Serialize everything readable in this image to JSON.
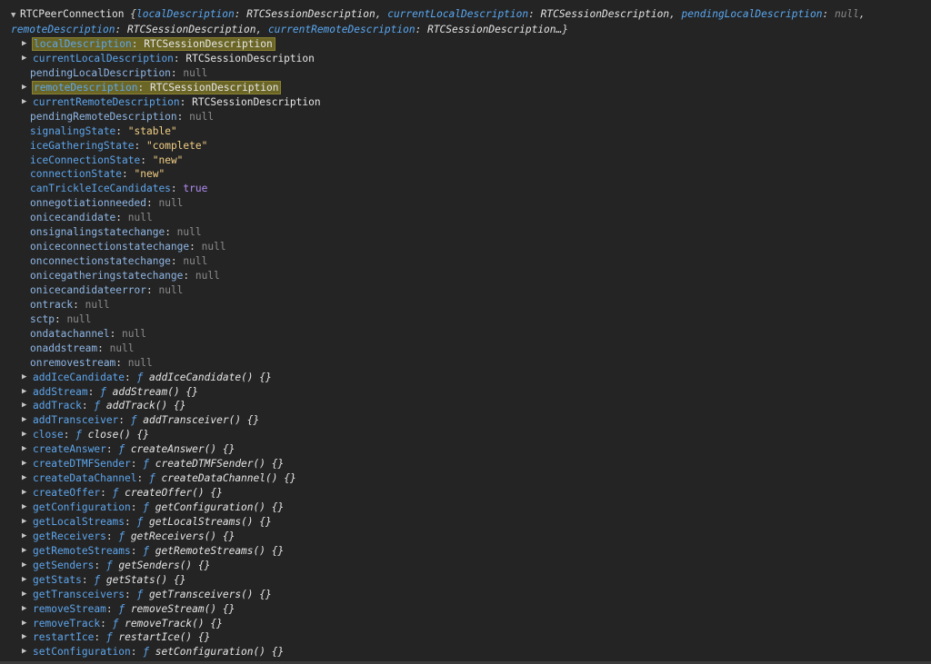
{
  "header": {
    "class_name": "RTCPeerConnection",
    "preview": [
      {
        "key": "localDescription",
        "value": "RTCSessionDescription",
        "type": "obj"
      },
      {
        "key": "currentLocalDescription",
        "value": "RTCSessionDescription",
        "type": "obj"
      },
      {
        "key": "pendingLocalDescription",
        "value": "null",
        "type": "null"
      },
      {
        "key": "remoteDescription",
        "value": "RTCSessionDescription",
        "type": "obj"
      },
      {
        "key": "currentRemoteDescription",
        "value": "RTCSessionDescription…",
        "type": "obj"
      }
    ]
  },
  "properties": [
    {
      "key": "localDescription",
      "value": "RTCSessionDescription",
      "type": "obj",
      "expandable": true,
      "highlight": true
    },
    {
      "key": "currentLocalDescription",
      "value": "RTCSessionDescription",
      "type": "obj",
      "expandable": true,
      "highlight": false
    },
    {
      "key": "pendingLocalDescription",
      "value": "null",
      "type": "null",
      "expandable": false
    },
    {
      "key": "remoteDescription",
      "value": "RTCSessionDescription",
      "type": "obj",
      "expandable": true,
      "highlight": true
    },
    {
      "key": "currentRemoteDescription",
      "value": "RTCSessionDescription",
      "type": "obj",
      "expandable": true,
      "highlight": false
    },
    {
      "key": "pendingRemoteDescription",
      "value": "null",
      "type": "null",
      "expandable": false
    },
    {
      "key": "signalingState",
      "value": "\"stable\"",
      "type": "str",
      "expandable": false
    },
    {
      "key": "iceGatheringState",
      "value": "\"complete\"",
      "type": "str",
      "expandable": false
    },
    {
      "key": "iceConnectionState",
      "value": "\"new\"",
      "type": "str",
      "expandable": false
    },
    {
      "key": "connectionState",
      "value": "\"new\"",
      "type": "str",
      "expandable": false
    },
    {
      "key": "canTrickleIceCandidates",
      "value": "true",
      "type": "bool",
      "expandable": false
    },
    {
      "key": "onnegotiationneeded",
      "value": "null",
      "type": "null",
      "expandable": false
    },
    {
      "key": "onicecandidate",
      "value": "null",
      "type": "null",
      "expandable": false
    },
    {
      "key": "onsignalingstatechange",
      "value": "null",
      "type": "null",
      "expandable": false
    },
    {
      "key": "oniceconnectionstatechange",
      "value": "null",
      "type": "null",
      "expandable": false
    },
    {
      "key": "onconnectionstatechange",
      "value": "null",
      "type": "null",
      "expandable": false
    },
    {
      "key": "onicegatheringstatechange",
      "value": "null",
      "type": "null",
      "expandable": false
    },
    {
      "key": "onicecandidateerror",
      "value": "null",
      "type": "null",
      "expandable": false
    },
    {
      "key": "ontrack",
      "value": "null",
      "type": "null",
      "expandable": false
    },
    {
      "key": "sctp",
      "value": "null",
      "type": "null",
      "expandable": false
    },
    {
      "key": "ondatachannel",
      "value": "null",
      "type": "null",
      "expandable": false
    },
    {
      "key": "onaddstream",
      "value": "null",
      "type": "null",
      "expandable": false
    },
    {
      "key": "onremovestream",
      "value": "null",
      "type": "null",
      "expandable": false
    },
    {
      "key": "addIceCandidate",
      "value": "addIceCandidate() {}",
      "type": "fn",
      "expandable": true
    },
    {
      "key": "addStream",
      "value": "addStream() {}",
      "type": "fn",
      "expandable": true
    },
    {
      "key": "addTrack",
      "value": "addTrack() {}",
      "type": "fn",
      "expandable": true
    },
    {
      "key": "addTransceiver",
      "value": "addTransceiver() {}",
      "type": "fn",
      "expandable": true
    },
    {
      "key": "close",
      "value": "close() {}",
      "type": "fn",
      "expandable": true
    },
    {
      "key": "createAnswer",
      "value": "createAnswer() {}",
      "type": "fn",
      "expandable": true
    },
    {
      "key": "createDTMFSender",
      "value": "createDTMFSender() {}",
      "type": "fn",
      "expandable": true
    },
    {
      "key": "createDataChannel",
      "value": "createDataChannel() {}",
      "type": "fn",
      "expandable": true
    },
    {
      "key": "createOffer",
      "value": "createOffer() {}",
      "type": "fn",
      "expandable": true
    },
    {
      "key": "getConfiguration",
      "value": "getConfiguration() {}",
      "type": "fn",
      "expandable": true
    },
    {
      "key": "getLocalStreams",
      "value": "getLocalStreams() {}",
      "type": "fn",
      "expandable": true
    },
    {
      "key": "getReceivers",
      "value": "getReceivers() {}",
      "type": "fn",
      "expandable": true
    },
    {
      "key": "getRemoteStreams",
      "value": "getRemoteStreams() {}",
      "type": "fn",
      "expandable": true
    },
    {
      "key": "getSenders",
      "value": "getSenders() {}",
      "type": "fn",
      "expandable": true
    },
    {
      "key": "getStats",
      "value": "getStats() {}",
      "type": "fn",
      "expandable": true
    },
    {
      "key": "getTransceivers",
      "value": "getTransceivers() {}",
      "type": "fn",
      "expandable": true
    },
    {
      "key": "removeStream",
      "value": "removeStream() {}",
      "type": "fn",
      "expandable": true
    },
    {
      "key": "removeTrack",
      "value": "removeTrack() {}",
      "type": "fn",
      "expandable": true
    },
    {
      "key": "restartIce",
      "value": "restartIce() {}",
      "type": "fn",
      "expandable": true
    },
    {
      "key": "setConfiguration",
      "value": "setConfiguration() {}",
      "type": "fn",
      "expandable": true
    }
  ],
  "glyphs": {
    "expanded": "▼",
    "collapsed": "▶",
    "function_mark": "ƒ",
    "colon": ": ",
    "comma": ", ",
    "brace_open": " {",
    "brace_close": "}"
  },
  "colors": {
    "background": "#242424",
    "enumerable_key": "#5ea6ed",
    "string_value": "#f2cf85",
    "boolean_value": "#b18cf5",
    "null_value": "#8c8c8c",
    "highlight": "#6b6626"
  }
}
